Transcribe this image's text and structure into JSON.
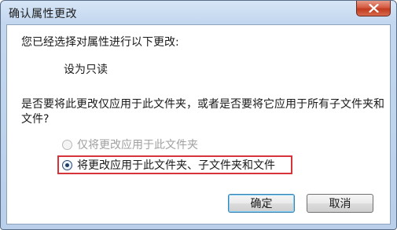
{
  "window": {
    "title": "确认属性更改"
  },
  "content": {
    "intro": "您已经选择对属性进行以下更改:",
    "attribute_change": "设为只读",
    "question": "是否要将此更改仅应用于此文件夹，或者是否要将它应用于所有子文件夹和文件?"
  },
  "options": [
    {
      "label": "仅将更改应用于此文件夹",
      "selected": false,
      "enabled": false
    },
    {
      "label": "将更改应用于此文件夹、子文件夹和文件",
      "selected": true,
      "enabled": true
    }
  ],
  "buttons": {
    "ok": "确定",
    "cancel": "取消"
  },
  "icons": {
    "close": "close-icon"
  },
  "colors": {
    "highlight_border": "#d6333b",
    "close_button": "#c03a1f"
  }
}
